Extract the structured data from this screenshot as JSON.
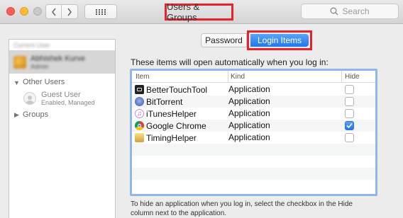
{
  "window": {
    "title": "Users & Groups",
    "search_placeholder": "Search"
  },
  "toolbar": {
    "back_icon": "chevron-left-icon",
    "forward_icon": "chevron-right-icon",
    "show_all_icon": "grid-icon"
  },
  "sidebar": {
    "current_user_header": "Current User",
    "current_user": {
      "name": "Abhishek Kurve",
      "role": "Admin"
    },
    "other_users_header": "Other Users",
    "guest": {
      "name": "Guest User",
      "status": "Enabled, Managed"
    },
    "groups_label": "Groups"
  },
  "tabs": {
    "password": "Password",
    "login_items": "Login Items",
    "selected": "login_items"
  },
  "main": {
    "intro": "These items will open automatically when you log in:",
    "columns": {
      "item": "Item",
      "kind": "Kind",
      "hide": "Hide"
    },
    "rows": [
      {
        "name": "BetterTouchTool",
        "kind": "Application",
        "hide": false,
        "icon": "bettertouchtool-icon"
      },
      {
        "name": "BitTorrent",
        "kind": "Application",
        "hide": false,
        "icon": "bittorrent-icon"
      },
      {
        "name": "iTunesHelper",
        "kind": "Application",
        "hide": false,
        "icon": "itunes-icon"
      },
      {
        "name": "Google Chrome",
        "kind": "Application",
        "hide": true,
        "icon": "chrome-icon"
      },
      {
        "name": "TimingHelper",
        "kind": "Application",
        "hide": false,
        "icon": "timing-icon"
      }
    ],
    "footer_line1": "To hide an application when you log in, select the checkbox in the Hide",
    "footer_line2": "column next to the application."
  },
  "colors": {
    "accent": "#1f77ec",
    "highlight_border": "#e8222a",
    "table_focus_ring": "#8fb7ea"
  }
}
